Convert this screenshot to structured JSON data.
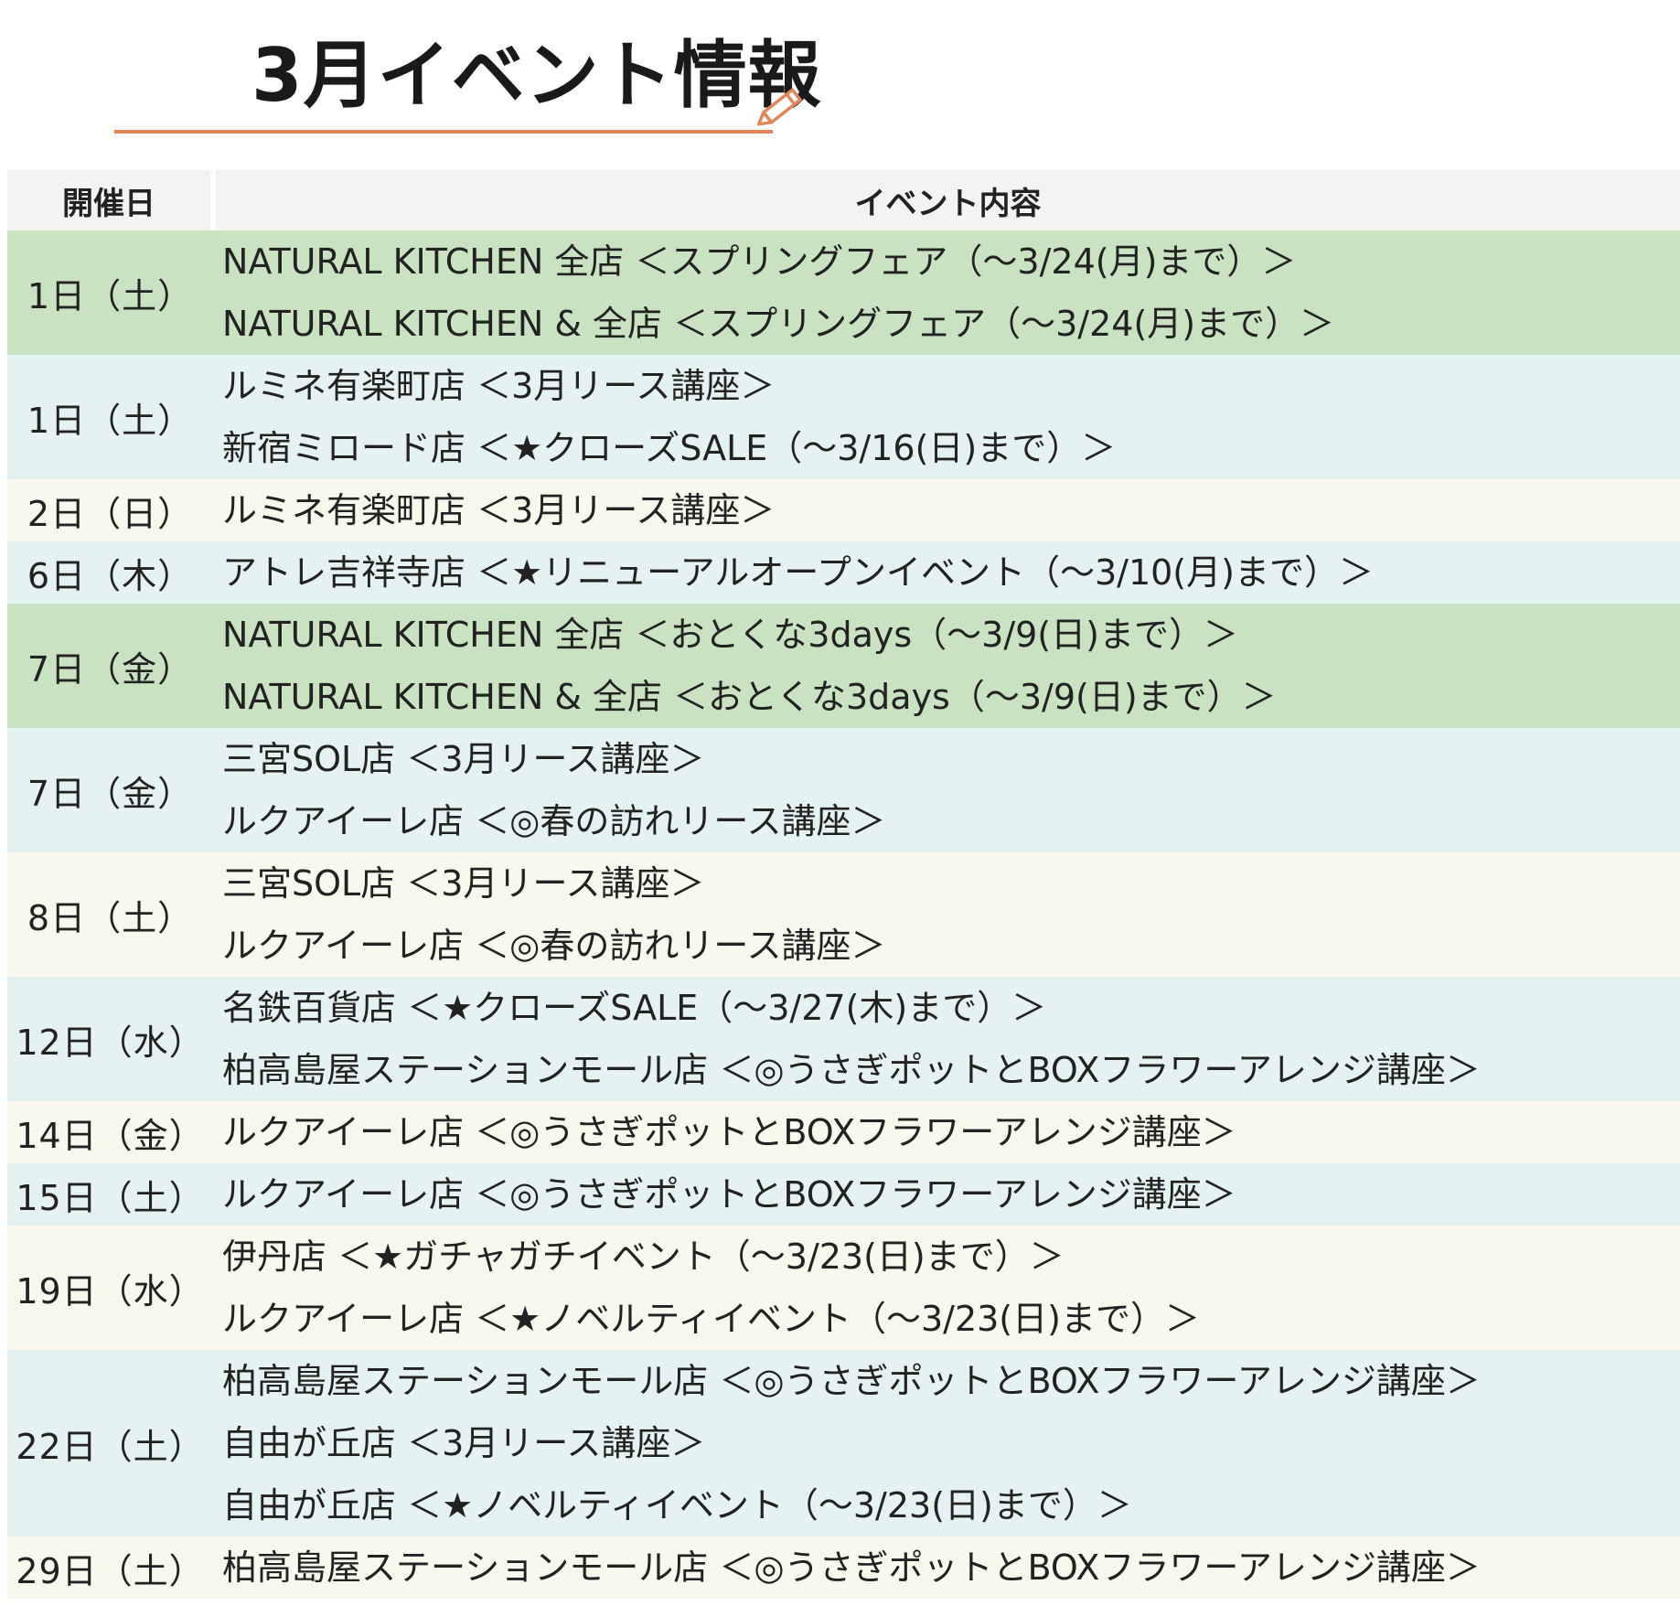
{
  "title": "3月イベント情報",
  "icons": {
    "title_decoration": "pencil-icon"
  },
  "colors": {
    "underline": "#e0875a",
    "header_bg": "#f3f3f3",
    "row_green": "#c9e3c2",
    "row_blue": "#e5f2f2",
    "row_yellow": "#f8f9ec"
  },
  "table": {
    "headers": {
      "date": "開催日",
      "content": "イベント内容"
    },
    "rows": [
      {
        "date": "1日（土）",
        "bg": "green",
        "events": [
          "NATURAL KITCHEN 全店 ＜スプリングフェア（～3/24(月)まで）＞",
          "NATURAL KITCHEN & 全店 ＜スプリングフェア（～3/24(月)まで）＞"
        ]
      },
      {
        "date": "1日（土）",
        "bg": "blue",
        "events": [
          "ルミネ有楽町店 ＜3月リース講座＞",
          "新宿ミロード店 ＜★クローズSALE（～3/16(日)まで）＞"
        ]
      },
      {
        "date": "2日（日）",
        "bg": "yellow",
        "events": [
          "ルミネ有楽町店 ＜3月リース講座＞"
        ]
      },
      {
        "date": "6日（木）",
        "bg": "blue",
        "events": [
          "アトレ吉祥寺店 ＜★リニューアルオープンイベント（～3/10(月)まで）＞"
        ]
      },
      {
        "date": "7日（金）",
        "bg": "green",
        "events": [
          "NATURAL KITCHEN 全店 ＜おとくな3days（～3/9(日)まで）＞",
          "NATURAL KITCHEN & 全店 ＜おとくな3days（～3/9(日)まで）＞"
        ]
      },
      {
        "date": "7日（金）",
        "bg": "blue",
        "events": [
          "三宮SOL店 ＜3月リース講座＞",
          "ルクアイーレ店 ＜◎春の訪れリース講座＞"
        ]
      },
      {
        "date": "8日（土）",
        "bg": "yellow",
        "events": [
          "三宮SOL店 ＜3月リース講座＞",
          "ルクアイーレ店 ＜◎春の訪れリース講座＞"
        ]
      },
      {
        "date": "12日（水）",
        "bg": "blue",
        "events": [
          "名鉄百貨店 ＜★クローズSALE（～3/27(木)まで）＞",
          "柏高島屋ステーションモール店 ＜◎うさぎポットとBOXフラワーアレンジ講座＞"
        ]
      },
      {
        "date": "14日（金）",
        "bg": "yellow",
        "events": [
          "ルクアイーレ店 ＜◎うさぎポットとBOXフラワーアレンジ講座＞"
        ]
      },
      {
        "date": "15日（土）",
        "bg": "blue",
        "events": [
          "ルクアイーレ店 ＜◎うさぎポットとBOXフラワーアレンジ講座＞"
        ]
      },
      {
        "date": "19日（水）",
        "bg": "yellow",
        "events": [
          "伊丹店 ＜★ガチャガチイベント（～3/23(日)まで）＞",
          "ルクアイーレ店 ＜★ノベルティイベント（～3/23(日)まで）＞"
        ]
      },
      {
        "date": "22日（土）",
        "bg": "blue",
        "events": [
          "柏高島屋ステーションモール店 ＜◎うさぎポットとBOXフラワーアレンジ講座＞",
          "自由が丘店 ＜3月リース講座＞",
          "自由が丘店 ＜★ノベルティイベント（～3/23(日)まで）＞"
        ]
      },
      {
        "date": "29日（土）",
        "bg": "yellow",
        "events": [
          "柏高島屋ステーションモール店 ＜◎うさぎポットとBOXフラワーアレンジ講座＞"
        ]
      }
    ]
  }
}
